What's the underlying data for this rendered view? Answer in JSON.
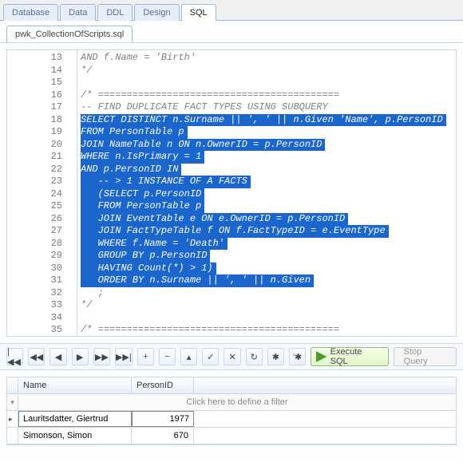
{
  "outer_tabs": {
    "database": "Database",
    "data": "Data",
    "ddl": "DDL",
    "design": "Design",
    "sql": "SQL"
  },
  "inner_tabs": {
    "file": "pwk_CollectionOfScripts.sql"
  },
  "code_lines": [
    {
      "n": 13,
      "t": "AND f.Name = 'Birth'",
      "cls": "comment"
    },
    {
      "n": 14,
      "t": "*/",
      "cls": "comment"
    },
    {
      "n": 15,
      "t": "",
      "cls": ""
    },
    {
      "n": 16,
      "t": "/* ==========================================",
      "cls": "comment"
    },
    {
      "n": 17,
      "t": "-- FIND DUPLICATE FACT TYPES USING SUBQUERY",
      "cls": "comment"
    },
    {
      "n": 18,
      "t": "SELECT DISTINCT n.Surname || ', ' || n.Given 'Name', p.PersonID",
      "cls": "sel"
    },
    {
      "n": 19,
      "t": "FROM PersonTable p",
      "cls": "sel"
    },
    {
      "n": 20,
      "t": "JOIN NameTable n ON n.OwnerID = p.PersonID",
      "cls": "sel"
    },
    {
      "n": 21,
      "t": "WHERE n.IsPrimary = 1",
      "cls": "sel"
    },
    {
      "n": 22,
      "t": "AND p.PersonID IN",
      "cls": "sel"
    },
    {
      "n": 23,
      "t": "   -- > 1 INSTANCE OF A FACTS",
      "cls": "sel"
    },
    {
      "n": 24,
      "t": "   (SELECT p.PersonID",
      "cls": "sel"
    },
    {
      "n": 25,
      "t": "   FROM PersonTable p",
      "cls": "sel"
    },
    {
      "n": 26,
      "t": "   JOIN EventTable e ON e.OwnerID = p.PersonID",
      "cls": "sel"
    },
    {
      "n": 27,
      "t": "   JOIN FactTypeTable f ON f.FactTypeID = e.EventType",
      "cls": "sel"
    },
    {
      "n": 28,
      "t": "   WHERE f.Name = 'Death'",
      "cls": "sel"
    },
    {
      "n": 29,
      "t": "   GROUP BY p.PersonID",
      "cls": "sel"
    },
    {
      "n": 30,
      "t": "   HAVING Count(*) > 1)",
      "cls": "sel"
    },
    {
      "n": 31,
      "t": "   ORDER BY n.Surname || ', ' || n.Given",
      "cls": "sel"
    },
    {
      "n": 32,
      "t": "   ;",
      "cls": "comment"
    },
    {
      "n": 33,
      "t": "*/",
      "cls": "comment"
    },
    {
      "n": 34,
      "t": "",
      "cls": ""
    },
    {
      "n": 35,
      "t": "/* ==========================================",
      "cls": "comment"
    }
  ],
  "toolbar": {
    "first": "|◀◀",
    "prev_page": "◀◀",
    "prev": "◀",
    "next": "▶",
    "next_page": "▶▶",
    "last": "▶▶|",
    "add": "+",
    "remove": "−",
    "edit": "▴",
    "commit": "✓",
    "cancel": "✕",
    "refresh": "↻",
    "star": "✱",
    "star2": "'✱",
    "execute": "Execute SQL",
    "stop": "Stop Query"
  },
  "results": {
    "columns": {
      "name": "Name",
      "id": "PersonID"
    },
    "filter_icon": "▾",
    "filter_placeholder": "Click here to define a filter",
    "rows": [
      {
        "name": "Lauritsdatter, Giertrud",
        "id": "1977",
        "active": true
      },
      {
        "name": "Simonson, Simon",
        "id": "670",
        "active": false
      }
    ]
  }
}
